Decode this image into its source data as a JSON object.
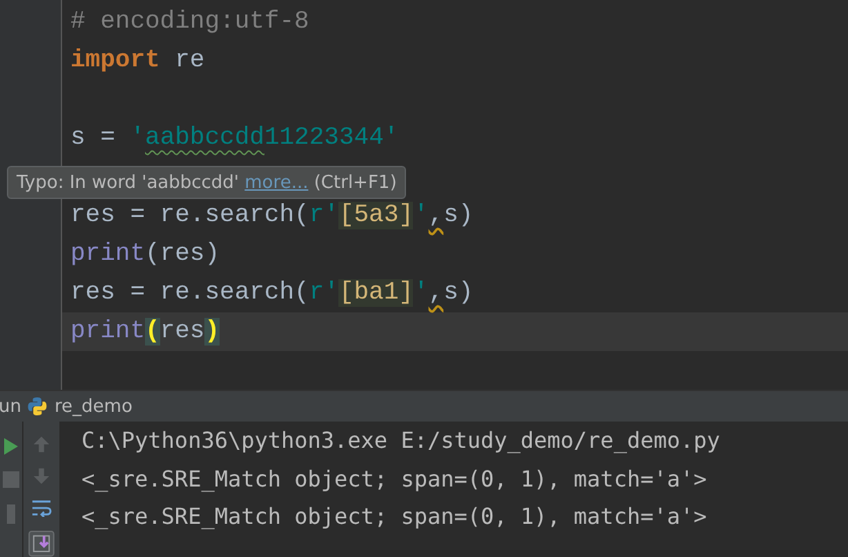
{
  "editor": {
    "lines": [
      {
        "current": false,
        "tokens": [
          {
            "text": "# encoding:utf-8",
            "kind": "comment"
          }
        ]
      },
      {
        "current": false,
        "tokens": [
          {
            "text": "import",
            "kind": "keyword"
          },
          {
            "text": " re",
            "kind": "text"
          }
        ]
      },
      {
        "current": false
      },
      {
        "current": false,
        "tokens": [
          {
            "text": "s = ",
            "kind": "text"
          },
          {
            "text": "'",
            "kind": "string"
          },
          {
            "text": "aabbccdd",
            "kind": "typo"
          },
          {
            "text": "11223344'",
            "kind": "string"
          }
        ]
      },
      {
        "current": false
      },
      {
        "current": false,
        "tokens": [
          {
            "text": "res = re.search(",
            "kind": "text"
          },
          {
            "text": "r'",
            "kind": "string"
          },
          {
            "text": "[5a3]",
            "kind": "regex"
          },
          {
            "text": "'",
            "kind": "string"
          },
          {
            "text": ",",
            "kind": "warning"
          },
          {
            "text": "s)",
            "kind": "text"
          }
        ]
      },
      {
        "current": false,
        "tokens": [
          {
            "text": "print",
            "kind": "builtin"
          },
          {
            "text": "(res)",
            "kind": "text"
          }
        ]
      },
      {
        "current": false,
        "tokens": [
          {
            "text": "res = re.search(",
            "kind": "text"
          },
          {
            "text": "r'",
            "kind": "string"
          },
          {
            "text": "[ba1]",
            "kind": "regex"
          },
          {
            "text": "'",
            "kind": "string"
          },
          {
            "text": ",",
            "kind": "warning"
          },
          {
            "text": "s)",
            "kind": "text"
          }
        ]
      },
      {
        "current": true,
        "tokens": [
          {
            "text": "print",
            "kind": "builtin"
          },
          {
            "text": "(",
            "kind": "brace"
          },
          {
            "text": "res",
            "kind": "text"
          },
          {
            "text": ")",
            "kind": "brace"
          }
        ]
      }
    ],
    "tooltip": {
      "before": "Typo: In word 'aabbccdd' ",
      "link": "more...",
      "after": " (Ctrl+F1)"
    }
  },
  "run_panel": {
    "label": "un",
    "config": "re_demo",
    "output": [
      "C:\\Python36\\python3.exe E:/study_demo/re_demo.py",
      "<_sre.SRE_Match object; span=(0, 1), match='a'>",
      "<_sre.SRE_Match object; span=(0, 1), match='a'>"
    ]
  }
}
